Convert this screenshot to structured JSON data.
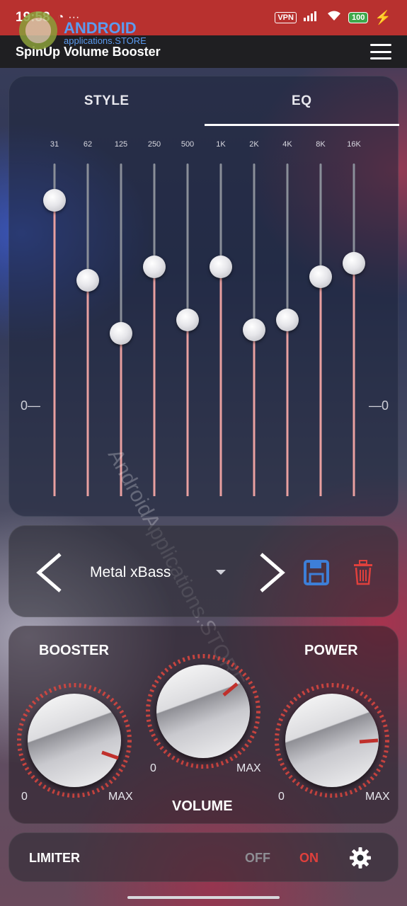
{
  "status_bar": {
    "time": "19:58",
    "vpn": "VPN",
    "battery": "100"
  },
  "app_bar": {
    "title": "SpinUp Volume Booster",
    "watermark_line1": "ANDROID",
    "watermark_line2": "applications.STORE"
  },
  "tabs": [
    {
      "label": "STYLE",
      "active": false
    },
    {
      "label": "EQ",
      "active": true
    }
  ],
  "equalizer": {
    "zero_label_left": "0—",
    "zero_label_right": "—0",
    "bands": [
      {
        "label": "31",
        "level": 0.89
      },
      {
        "label": "62",
        "level": 0.65
      },
      {
        "label": "125",
        "level": 0.49
      },
      {
        "label": "250",
        "level": 0.69
      },
      {
        "label": "500",
        "level": 0.53
      },
      {
        "label": "1K",
        "level": 0.69
      },
      {
        "label": "2K",
        "level": 0.5
      },
      {
        "label": "4K",
        "level": 0.53
      },
      {
        "label": "8K",
        "level": 0.66
      },
      {
        "label": "16K",
        "level": 0.7
      }
    ]
  },
  "preset": {
    "name": "Metal xBass"
  },
  "knobs": {
    "booster": {
      "title": "BOOSTER",
      "min": "0",
      "max": "MAX"
    },
    "volume": {
      "title": "VOLUME",
      "min": "0",
      "max": "MAX"
    },
    "power": {
      "title": "POWER",
      "min": "0",
      "max": "MAX"
    }
  },
  "limiter": {
    "label": "LIMITER",
    "off": "OFF",
    "on": "ON",
    "state": "ON"
  },
  "watermark_text": "AndroidApplications.STORE",
  "colors": {
    "accent_red": "#e0403c",
    "save_blue": "#3d7fd8",
    "status_bar": "#b8312f"
  }
}
